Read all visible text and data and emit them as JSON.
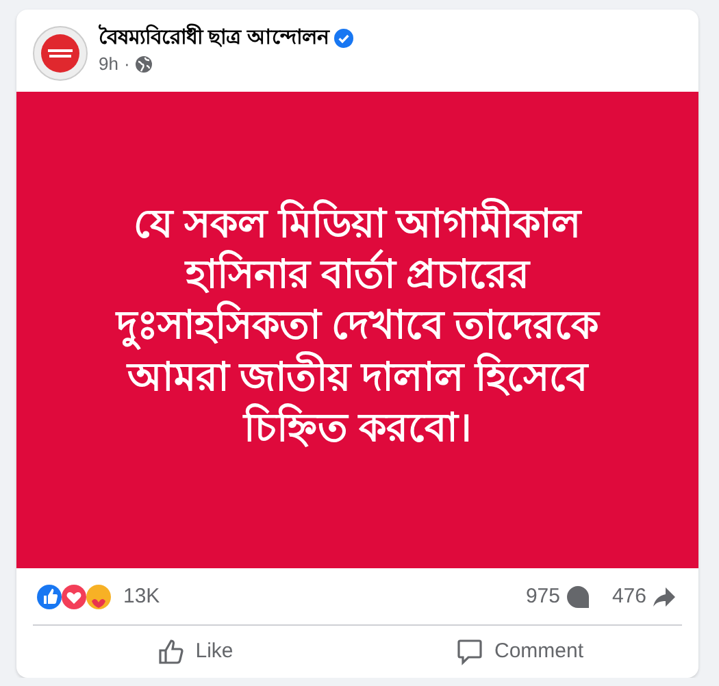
{
  "post": {
    "author": "বৈষম্যবিরোধী ছাত্র আন্দোলন",
    "verified": true,
    "time": "9h",
    "separator": "·",
    "public": true,
    "image_text": [
      "যে সকল মিডিয়া আগামীকাল",
      "হাসিনার বার্তা প্রচারের",
      "দুঃসাহসিকতা দেখাবে তাদেরকে",
      "আমরা জাতীয় দালাল হিসেবে",
      "চিহ্নিত করবো।"
    ],
    "reactions_count": "13K",
    "comments_count": "975",
    "shares_count": "476",
    "actions": [
      {
        "kind": "like",
        "label": "Like"
      },
      {
        "kind": "comment",
        "label": "Comment"
      }
    ]
  }
}
